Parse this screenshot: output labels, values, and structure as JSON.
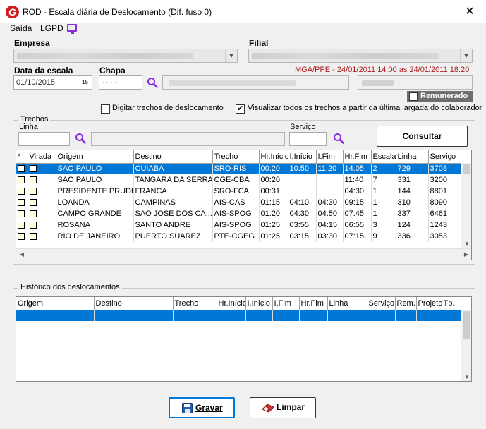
{
  "window": {
    "title": "ROD - Escala diária de Deslocamento (Dif. fuso 0)",
    "logo_letter": "G",
    "close_glyph": "✕"
  },
  "menu": {
    "exit": "Saída",
    "lgpd": "LGPD"
  },
  "empresa": {
    "label": "Empresa"
  },
  "filial": {
    "label": "Filial"
  },
  "data_escala": {
    "label": "Data da escala",
    "value": "01/10/2015",
    "calendar_glyph": "15"
  },
  "chapa": {
    "label": "Chapa",
    "value": "······"
  },
  "mga_info": "MGA/PPE - 24/01/2011 14:00 as 24/01/2011 18:20",
  "remunerado": {
    "label": "Remunerado",
    "checked": false
  },
  "options": {
    "digitar_label": "Digitar trechos de deslocamento",
    "visualizar_label": "Visualizar todos os trechos a partir da última largada do colaborador"
  },
  "trechos": {
    "group_title": "Trechos",
    "linha_label": "Linha",
    "servico_label": "Serviço",
    "consultar_label": "Consultar",
    "columns": [
      "*",
      "Virada",
      "Origem",
      "Destino",
      "Trecho",
      "Hr.Início",
      "I.Início",
      "I.Fim",
      "Hr.Fim",
      "Escala",
      "Linha",
      "Serviço"
    ],
    "rows": [
      [
        "SAO PAULO",
        "CUIABA",
        "SRO-RIS",
        "00:20",
        "10:50",
        "11:20",
        "14:05",
        "2",
        "729",
        "3703"
      ],
      [
        "SAO PAULO",
        "TANGARA DA SERRA",
        "CGE-CBA",
        "00:20",
        "",
        "",
        "11:40",
        "7",
        "331",
        "3200"
      ],
      [
        "PRESIDENTE PRUDE...",
        "FRANCA",
        "SRO-FCA",
        "00:31",
        "",
        "",
        "04:30",
        "1",
        "144",
        "8801"
      ],
      [
        "LOANDA",
        "CAMPINAS",
        "AIS-CAS",
        "01:15",
        "04:10",
        "04:30",
        "09:15",
        "1",
        "310",
        "8090"
      ],
      [
        "CAMPO GRANDE",
        "SAO JOSE DOS CA...",
        "AIS-SPOG",
        "01:20",
        "04:30",
        "04:50",
        "07:45",
        "1",
        "337",
        "6461"
      ],
      [
        "ROSANA",
        "SANTO ANDRE",
        "AIS-SPOG",
        "01:25",
        "03:55",
        "04:15",
        "06:55",
        "3",
        "124",
        "1243"
      ],
      [
        "RIO DE JANEIRO",
        "PUERTO SUAREZ",
        "PTE-CGEG",
        "01:25",
        "03:15",
        "03:30",
        "07:15",
        "9",
        "336",
        "3053"
      ]
    ],
    "selected_row": 0
  },
  "historico": {
    "group_title": "Histórico dos deslocamentos",
    "columns": [
      "Origem",
      "Destino",
      "Trecho",
      "Hr.Início",
      "I.Início",
      "I.Fim",
      "Hr.Fim",
      "Linha",
      "Serviço",
      "Rem.",
      "Projeto",
      "Tp."
    ]
  },
  "buttons": {
    "gravar": "Gravar",
    "limpar": "Limpar"
  },
  "colors": {
    "selection": "#0078d7",
    "accent_purple": "#8a2be2",
    "red_info": "#b0191e"
  }
}
